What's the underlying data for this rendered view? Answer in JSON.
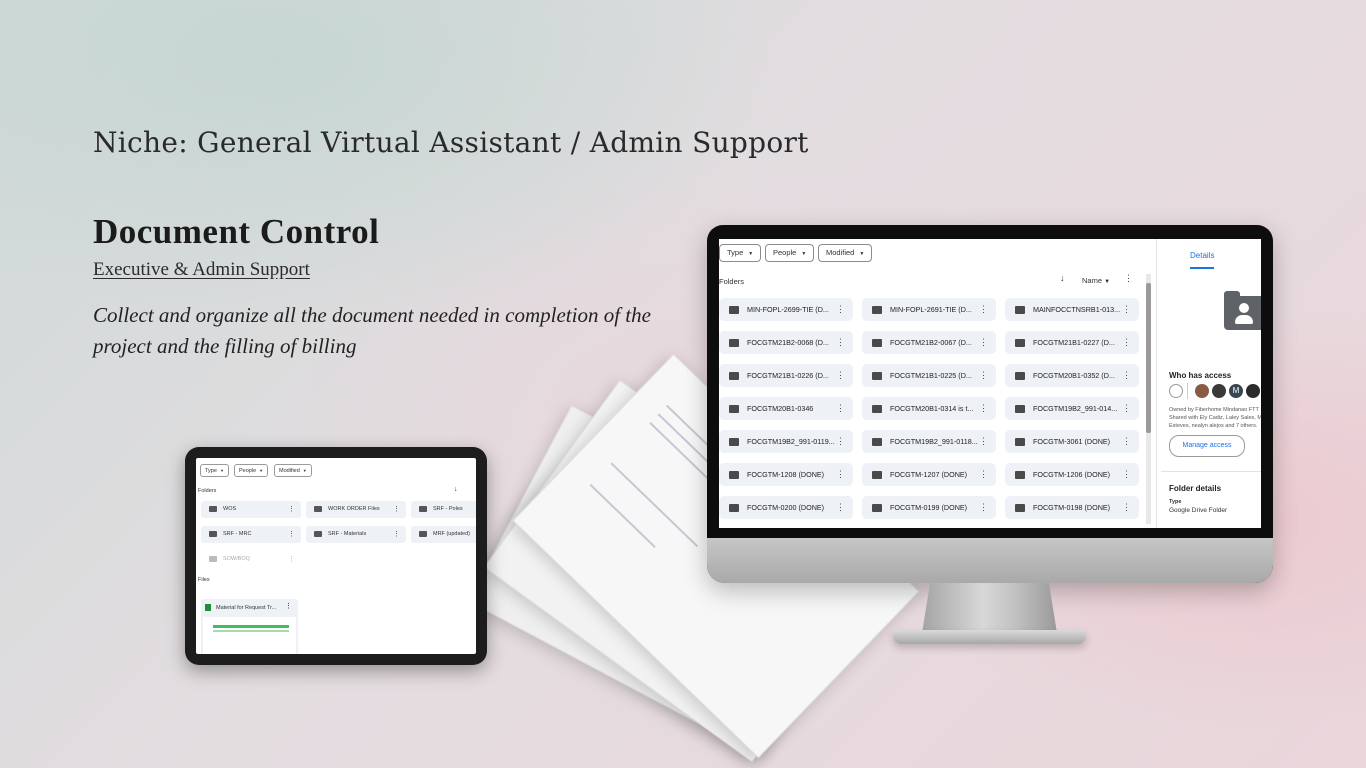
{
  "header": {
    "niche": "Niche: General Virtual Assistant / Admin Support",
    "title": "Document Control",
    "subtitle": "Executive & Admin Support",
    "description": "Collect and organize all the document needed in completion of the project and the filling of billing"
  },
  "tablet": {
    "filters": [
      "Type",
      "People",
      "Modified"
    ],
    "folders_label": "Folders",
    "folders": [
      "WOS",
      "WORK ORDER Files",
      "SRF - Poles",
      "SRF - MRC",
      "SRF - Materials",
      "MRF (updated)",
      "SOW/BOQ"
    ],
    "files_label": "Files",
    "file_name": "Material for Request Tr..."
  },
  "monitor": {
    "filters": [
      "Type",
      "People",
      "Modified"
    ],
    "folders_label": "Folders",
    "sort_label": "Name",
    "folders": [
      "MIN-FOPL-2699-TIE (D...",
      "MIN-FOPL-2691-TIE (D...",
      "MAINFOCCTNSRB1-013...",
      "FOCGTM21B2-0068 (D...",
      "FOCGTM21B2-0067 (D...",
      "FOCGTM21B1-0227 (D...",
      "FOCGTM21B1-0226 (D...",
      "FOCGTM21B1-0225 (D...",
      "FOCGTM20B1-0352 (D...",
      "FOCGTM20B1-0346",
      "FOCGTM20B1-0314 is t...",
      "FOCGTM19B2_991-014...",
      "FOCGTM19B2_991-0119...",
      "FOCGTM19B2_991-0118...",
      "FOCGTM-3061 (DONE)",
      "FOCGTM-1208 (DONE)",
      "FOCGTM-1207 (DONE)",
      "FOCGTM-1206 (DONE)",
      "FOCGTM-0200 (DONE)",
      "FOCGTM-0199 (DONE)",
      "FOCGTM-0198 (DONE)"
    ],
    "details": {
      "tab": "Details",
      "who_has_access": "Who has access",
      "owner_line": "Owned by Fiberhome Mindanao FTT",
      "shared_line": "Shared with Ely Cadiz, Laley Sales, M",
      "shared_line2": "Esteves, nealyn alejos and 7 others.",
      "manage_access": "Manage access",
      "folder_details": "Folder details",
      "type_label": "Type",
      "type_value": "Google Drive Folder",
      "avatar_letter": "M"
    }
  },
  "colors": {
    "accent": "#1a73e8",
    "card": "#eef1f6",
    "folder_icon": "#4a4a4a"
  }
}
